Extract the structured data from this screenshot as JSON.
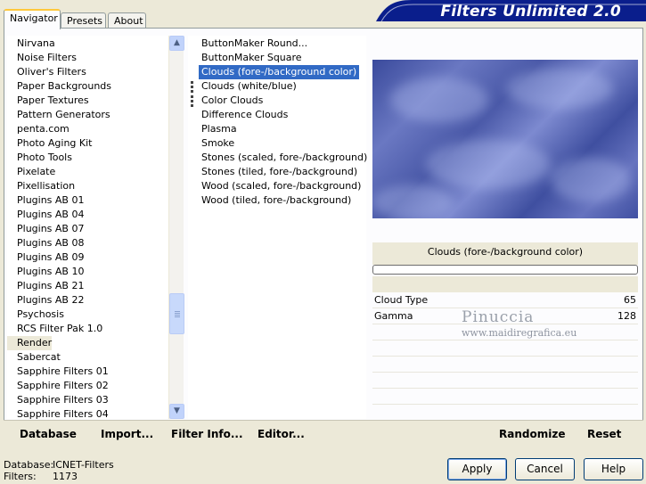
{
  "tabs": {
    "navigator": "Navigator",
    "presets": "Presets",
    "about": "About"
  },
  "banner": {
    "title": "Filters Unlimited 2.0"
  },
  "categories": [
    "Nirvana",
    "Noise Filters",
    "Oliver's Filters",
    "Paper Backgrounds",
    "Paper Textures",
    "Pattern Generators",
    "penta.com",
    "Photo Aging Kit",
    "Photo Tools",
    "Pixelate",
    "Pixellisation",
    "Plugins AB 01",
    "Plugins AB 04",
    "Plugins AB 07",
    "Plugins AB 08",
    "Plugins AB 09",
    "Plugins AB 10",
    "Plugins AB 21",
    "Plugins AB 22",
    "Psychosis",
    "RCS Filter Pak 1.0",
    "Render",
    "Sabercat",
    "Sapphire Filters 01",
    "Sapphire Filters 02",
    "Sapphire Filters 03",
    "Sapphire Filters 04"
  ],
  "selected_category": "Render",
  "effects": [
    "ButtonMaker Round...",
    "ButtonMaker Square",
    "Clouds (fore-/background color)",
    "Clouds (white/blue)",
    "Color Clouds",
    "Difference Clouds",
    "Plasma",
    "Smoke",
    "Stones (scaled, fore-/background)",
    "Stones (tiled, fore-/background)",
    "Wood (scaled, fore-/background)",
    "Wood (tiled, fore-/background)"
  ],
  "selected_effect": "Clouds (fore-/background color)",
  "preview": {
    "label": "Clouds (fore-/background color)"
  },
  "params": [
    {
      "name": "Cloud Type",
      "value": "65"
    },
    {
      "name": "Gamma",
      "value": "128"
    }
  ],
  "watermark": {
    "line1": "Pinuccia",
    "line2": "www.maidiregrafica.eu"
  },
  "bottom": {
    "database": "Database",
    "import": "Import...",
    "filter_info": "Filter Info...",
    "editor": "Editor...",
    "randomize": "Randomize",
    "reset": "Reset"
  },
  "buttons": {
    "apply": "Apply",
    "cancel": "Cancel",
    "help": "Help"
  },
  "status": {
    "database_label": "Database:",
    "database_value": "ICNET-Filters",
    "filters_label": "Filters:",
    "filters_value": "1173"
  },
  "colors": {
    "selection": "#316ac5",
    "banner": "#0a1e8c"
  }
}
